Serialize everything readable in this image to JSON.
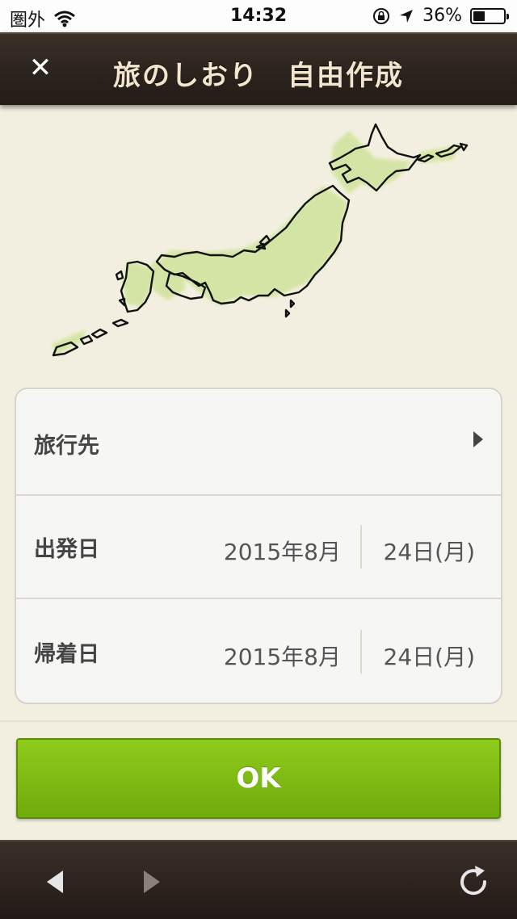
{
  "status_bar": {
    "carrier": "圏外",
    "time": "14:32",
    "battery": "36%"
  },
  "header": {
    "title": "旅のしおり　自由作成",
    "close_icon": "close-icon"
  },
  "form": {
    "destination": {
      "label": "旅行先"
    },
    "departure": {
      "label": "出発日",
      "year_month": "2015年8月",
      "day": "24日(月)"
    },
    "return": {
      "label": "帰着日",
      "year_month": "2015年8月",
      "day": "24日(月)"
    }
  },
  "ok_button": {
    "label": "OK"
  },
  "toolbar": {
    "back": "back-arrow-icon",
    "forward": "forward-arrow-icon",
    "reload": "reload-icon"
  },
  "colors": {
    "accent_green": "#7dbd14",
    "header_brown": "#2a221c",
    "background": "#f3efe0"
  }
}
